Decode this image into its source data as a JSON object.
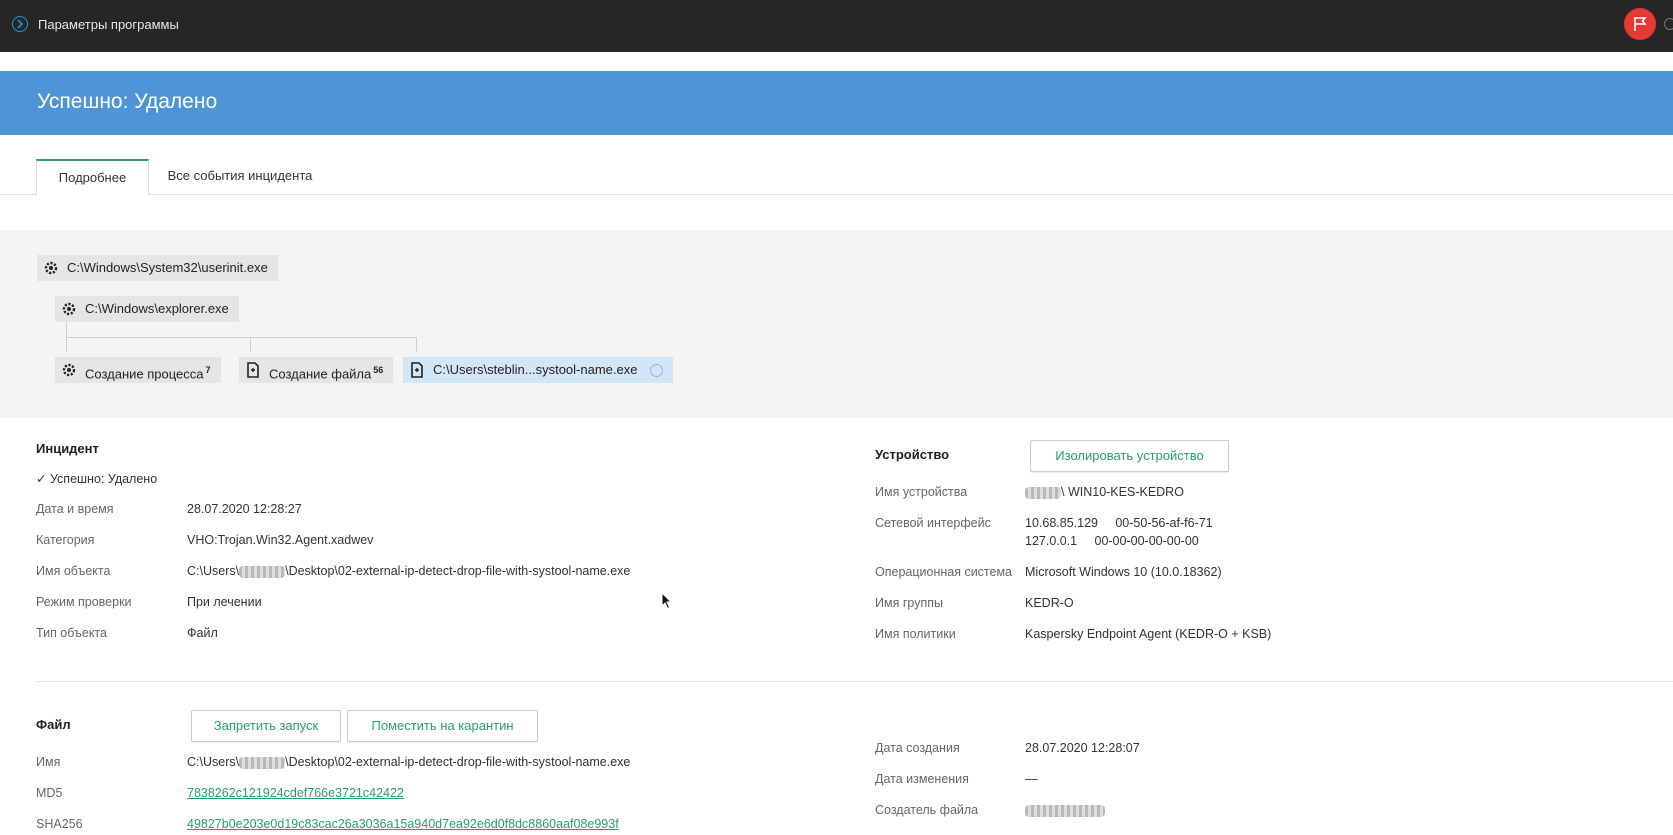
{
  "topbar": {
    "title": "Параметры программы",
    "back_icon": "circle-arrow-icon",
    "flag_icon": "flag-icon",
    "accent": "#e53935"
  },
  "banner": {
    "text": "Успешно: Удалено",
    "color": "#4f95d6"
  },
  "tabs": [
    {
      "label": "Подробнее"
    },
    {
      "label": "Все события инцидента"
    }
  ],
  "tree": {
    "nodes": [
      {
        "label": "C:\\Windows\\System32\\userinit.exe",
        "icon": "gear-icon"
      },
      {
        "label": "C:\\Windows\\explorer.exe",
        "icon": "gear-icon"
      },
      {
        "label": "Создание процесса",
        "count": "7",
        "icon": "gear-icon"
      },
      {
        "label": "Создание файла",
        "count": "56",
        "icon": "file-icon"
      },
      {
        "label": "C:\\Users\\steblin...systool-name.exe",
        "icon": "file-icon"
      }
    ]
  },
  "incident": {
    "title": "Инцидент",
    "status": "✓ Успешно: Удалено",
    "rows": [
      {
        "label": "Дата и время",
        "value": "28.07.2020 12:28:27"
      },
      {
        "label": "Категория",
        "value": "VHO:Trojan.Win32.Agent.xadwev"
      },
      {
        "label": "Имя объекта",
        "value_prefix": "C:\\Users\\",
        "value_suffix": "\\Desktop\\02-external-ip-detect-drop-file-with-systool-name.exe"
      },
      {
        "label": "Режим проверки",
        "value": "При лечении"
      },
      {
        "label": "Тип объекта",
        "value": "Файл"
      }
    ]
  },
  "device": {
    "title": "Устройство",
    "isolate_button": "Изолировать устройство",
    "rows": [
      {
        "label": "Имя устройства",
        "value": "\\ WIN10-KES-KEDRO"
      },
      {
        "label": "Сетевой интерфейс",
        "value": "10.68.85.129     00-50-56-af-f6-71",
        "value2": "127.0.0.1     00-00-00-00-00-00"
      },
      {
        "label": "Операционная система",
        "value": "Microsoft Windows 10 (10.0.18362)"
      },
      {
        "label": "Имя группы",
        "value": "KEDR-O"
      },
      {
        "label": "Имя политики",
        "value": "Kaspersky Endpoint Agent (KEDR-O + KSB)"
      }
    ]
  },
  "file": {
    "title": "Файл",
    "block_button": "Запретить запуск",
    "quarantine_button": "Поместить на карантин",
    "rows": [
      {
        "label": "Имя",
        "value_prefix": "C:\\Users\\",
        "value_suffix": "\\Desktop\\02-external-ip-detect-drop-file-with-systool-name.exe"
      },
      {
        "label": "MD5",
        "value": "7838262c121924cdef766e3721c42422"
      },
      {
        "label": "SHA256",
        "value": "49827b0e203e0d19c83cac26a3036a15a940d7ea92e6d0f8dc8860aaf08e993f"
      }
    ],
    "meta": [
      {
        "label": "Дата создания",
        "value": "28.07.2020 12:28:07"
      },
      {
        "label": "Дата изменения",
        "value": "—"
      },
      {
        "label": "Создатель файла",
        "value": ""
      }
    ]
  }
}
